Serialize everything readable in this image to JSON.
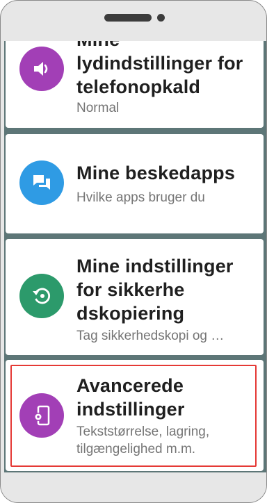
{
  "device": {
    "speaker": "speaker-grille",
    "camera": "front-camera"
  },
  "settings": {
    "items": [
      {
        "title_lines": [
          "Mine",
          "lydindstillinger for",
          "telefonopkald"
        ],
        "subtitle": "Normal",
        "icon": "speaker-volume-icon",
        "color": "#a23fb6"
      },
      {
        "title_lines": [
          "Mine beskedapps"
        ],
        "subtitle": "Hvilke apps bruger du",
        "icon": "chat-bubbles-icon",
        "color": "#2f9be4"
      },
      {
        "title_lines": [
          "Mine indstillinger",
          "for sikkerhe",
          "dskopiering"
        ],
        "subtitle": "Tag sikkerhedskopi og …",
        "icon": "backup-restore-icon",
        "color": "#2c9a6b"
      },
      {
        "title_lines": [
          "Avancerede",
          "indstillinger"
        ],
        "subtitle_lines": [
          "Tekststørrelse, lagring,",
          "tilgængelighed m.m."
        ],
        "icon": "phone-settings-icon",
        "color": "#a23fb6",
        "highlighted": true
      }
    ]
  }
}
